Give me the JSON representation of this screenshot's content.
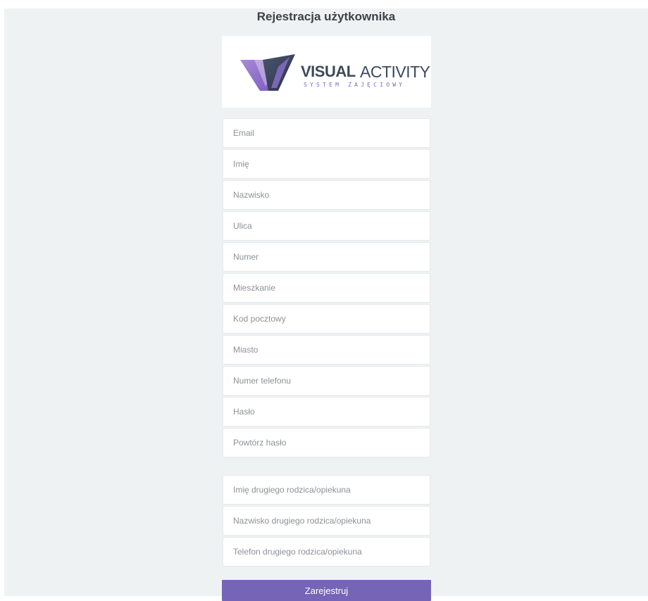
{
  "page": {
    "title": "Rejestracja użytkownika"
  },
  "logo": {
    "brand_bold": "VISUAL",
    "brand_light": "ACTIVITY",
    "tagline": "SYSTEM ZAJĘCIOWY",
    "colors": {
      "purple": "#8a6cc6",
      "dark": "#3d4a5c"
    }
  },
  "main_fields": [
    {
      "placeholder": "Email"
    },
    {
      "placeholder": "Imię"
    },
    {
      "placeholder": "Nazwisko"
    },
    {
      "placeholder": "Ulica"
    },
    {
      "placeholder": "Numer"
    },
    {
      "placeholder": "Mieszkanie"
    },
    {
      "placeholder": "Kod pocztowy"
    },
    {
      "placeholder": "Miasto"
    },
    {
      "placeholder": "Numer telefonu"
    },
    {
      "placeholder": "Hasło"
    },
    {
      "placeholder": "Powtórz hasło"
    }
  ],
  "second_parent_fields": [
    {
      "placeholder": "Imię drugiego rodzica/opiekuna"
    },
    {
      "placeholder": "Nazwisko drugiego rodzica/opiekuna"
    },
    {
      "placeholder": "Telefon drugiego rodzica/opiekuna"
    }
  ],
  "submit": {
    "label": "Zarejestruj",
    "color": "#7664b7"
  }
}
